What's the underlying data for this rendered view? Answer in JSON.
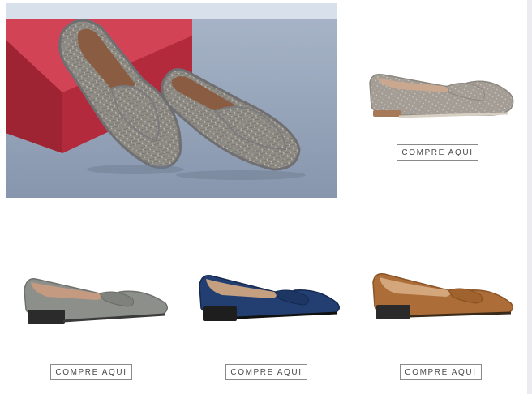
{
  "hero": {
    "image": "studded-grey-loafers-on-red-box"
  },
  "products": [
    {
      "name": "grey-studded-loafer",
      "button_label": "COMPRE AQUI",
      "color": "#a39d95"
    },
    {
      "name": "grey-suede-pointed-loafer",
      "button_label": "COMPRE AQUI",
      "color": "#8d8f8b"
    },
    {
      "name": "navy-suede-pointed-loafer",
      "button_label": "COMPRE AQUI",
      "color": "#233f72"
    },
    {
      "name": "tan-suede-pointed-loafer",
      "button_label": "COMPRE AQUI",
      "color": "#ad6d38"
    }
  ]
}
